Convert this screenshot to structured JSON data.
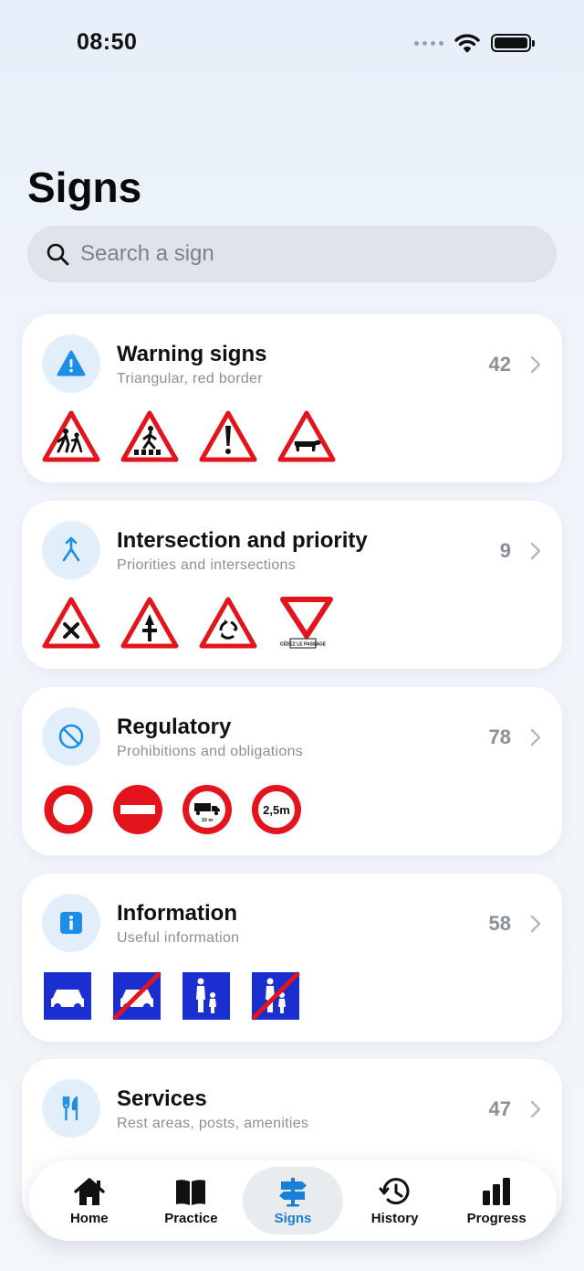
{
  "status_bar": {
    "time": "08:50"
  },
  "page": {
    "title": "Signs"
  },
  "search": {
    "placeholder": "Search a sign"
  },
  "categories": [
    {
      "title": "Warning signs",
      "subtitle": "Triangular, red border",
      "count": "42",
      "icon": "warning-icon"
    },
    {
      "title": "Intersection and priority",
      "subtitle": "Priorities and intersections",
      "count": "9",
      "icon": "merge-arrow-icon"
    },
    {
      "title": "Regulatory",
      "subtitle": "Prohibitions and obligations",
      "count": "78",
      "icon": "prohibition-icon"
    },
    {
      "title": "Information",
      "subtitle": "Useful information",
      "count": "58",
      "icon": "info-icon"
    },
    {
      "title": "Services",
      "subtitle": "Rest areas, posts, amenities",
      "count": "47",
      "icon": "fork-knife-icon"
    }
  ],
  "sign_texts": {
    "yield": "CÉDEZ LE PASSAGE",
    "length_10m": "10 m",
    "width_limit": "2,5m"
  },
  "tabs": [
    {
      "label": "Home",
      "icon": "house-icon",
      "active": false
    },
    {
      "label": "Practice",
      "icon": "book-icon",
      "active": false
    },
    {
      "label": "Signs",
      "icon": "signpost-icon",
      "active": true
    },
    {
      "label": "History",
      "icon": "history-icon",
      "active": false
    },
    {
      "label": "Progress",
      "icon": "bar-chart-icon",
      "active": false
    }
  ],
  "colors": {
    "accent": "#1a7fd6",
    "sign_red": "#e3141b",
    "sign_blue": "#1b2fd1",
    "icon_bg": "#e2effb"
  }
}
